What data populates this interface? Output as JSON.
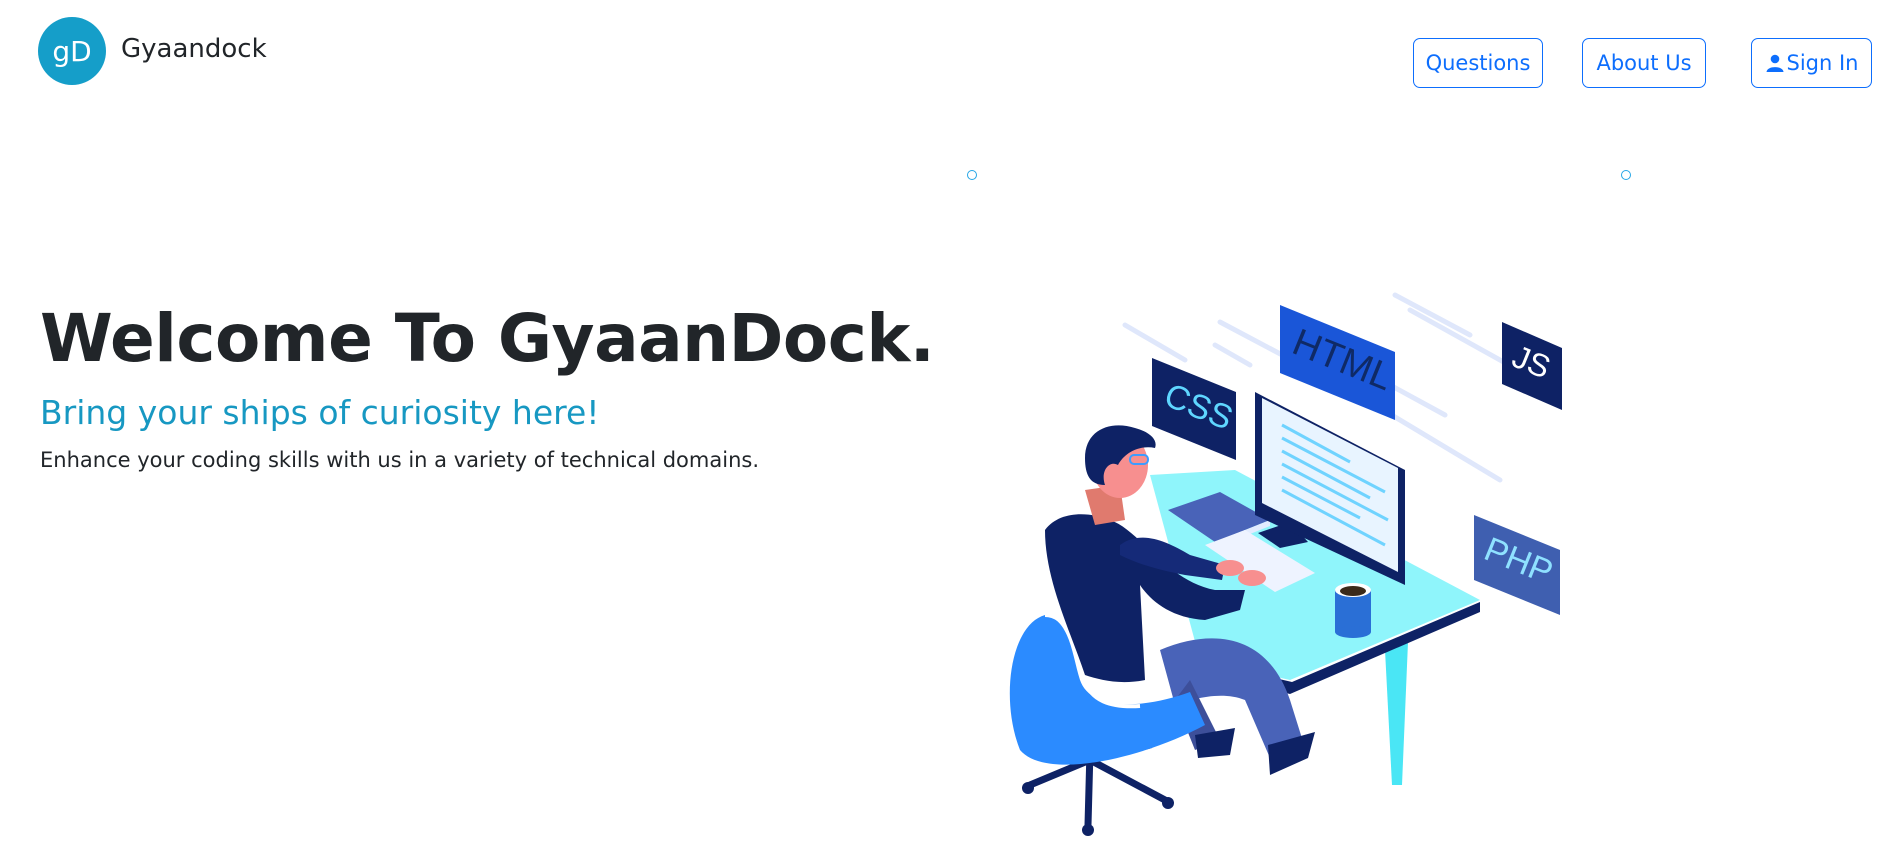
{
  "brand": {
    "logo_text": "gD",
    "name": "Gyaandock"
  },
  "nav": {
    "questions_label": "Questions",
    "about_label": "About Us",
    "signin_label": "Sign In",
    "accent_color": "#0d6efd"
  },
  "hero": {
    "title": "Welcome To GyaanDock.",
    "subtitle": "Bring your ships of curiosity here!",
    "description": "Enhance your coding skills with us in a variety of technical domains.",
    "subtitle_color": "#1798c2"
  },
  "illustration": {
    "tags": [
      "HTML",
      "CSS",
      "JS",
      "PHP"
    ]
  },
  "icons": {
    "signin": "person-icon",
    "illustration": "developer-at-desk-illustration"
  }
}
